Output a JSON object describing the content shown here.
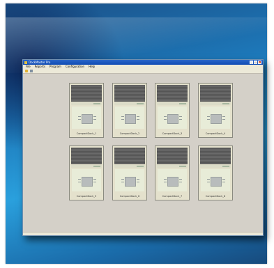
{
  "window": {
    "title": "DockMaster Pro"
  },
  "menu": [
    "File",
    "Reports",
    "Program",
    "Configuration",
    "Help"
  ],
  "toolbar": [
    "open-folder-icon",
    "settings-icon"
  ],
  "cards": [
    {
      "label": "CompactDock_1"
    },
    {
      "label": "CompactDock_2"
    },
    {
      "label": "CompactDock_3"
    },
    {
      "label": "CompactDock_4"
    },
    {
      "label": "CompactDock_5"
    },
    {
      "label": "CompactDock_6"
    },
    {
      "label": "CompactDock_7"
    },
    {
      "label": "CompactDock_8"
    }
  ]
}
